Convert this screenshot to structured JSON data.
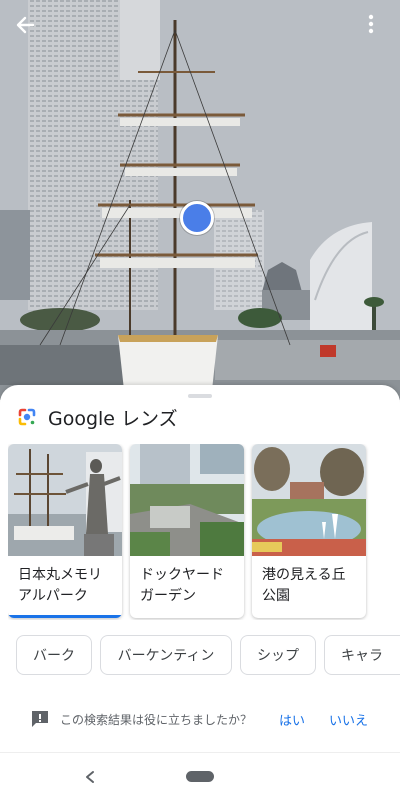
{
  "photo": {
    "back_icon": "arrow-back-icon",
    "menu_icon": "more-vert-icon"
  },
  "sheet": {
    "title": "Google レンズ",
    "logo_icon": "google-lens-icon"
  },
  "results": [
    {
      "title": "日本丸メモリアルパーク",
      "line1": "日本丸メモリ",
      "line2": "アルパーク",
      "selected": true
    },
    {
      "title": "ドックヤードガーデン",
      "line1": "ドックヤード",
      "line2": "ガーデン",
      "selected": false
    },
    {
      "title": "港の見える丘公園",
      "line1": "港の見える丘",
      "line2": "公園",
      "selected": false
    }
  ],
  "chips": [
    {
      "label": "バーク"
    },
    {
      "label": "バーケンティン"
    },
    {
      "label": "シップ"
    },
    {
      "label": "キャラ"
    }
  ],
  "feedback": {
    "question": "この検索結果は役に立ちましたか？",
    "yes": "はい",
    "no": "いいえ",
    "icon": "feedback-icon"
  },
  "navbar": {
    "back_icon": "nav-back-icon",
    "home_icon": "nav-home-pill"
  },
  "colors": {
    "accent": "#1a73e8",
    "lens_dot": "#4a7ee8"
  }
}
